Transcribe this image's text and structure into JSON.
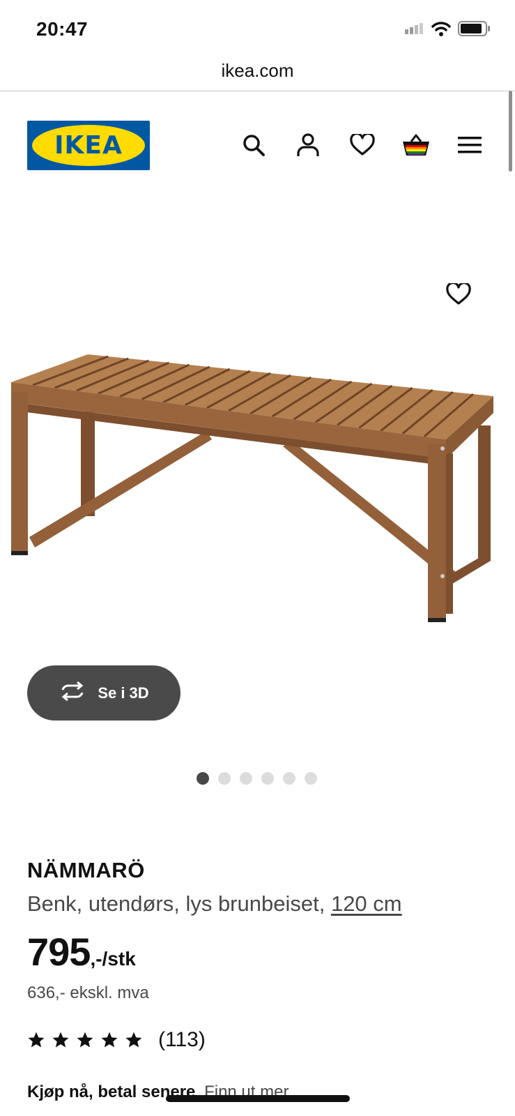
{
  "status_bar": {
    "time": "20:47",
    "icons": [
      "signal-icon",
      "wifi-icon",
      "battery-icon"
    ]
  },
  "browser": {
    "url": "ikea.com"
  },
  "header": {
    "logo_text": "IKEA",
    "icons": [
      "search-icon",
      "account-icon",
      "favorites-icon",
      "basket-icon",
      "menu-icon"
    ]
  },
  "product_image": {
    "view_3d_label": "Se i 3D",
    "carousel": {
      "total": 6,
      "active": 1
    }
  },
  "product": {
    "name": "NÄMMARÖ",
    "description": "Benk, utendørs, lys brunbeiset,",
    "size_link": "120 cm",
    "price_main": "795",
    "price_suffix": ",-/stk",
    "price_excl_vat": "636,- ekskl. mva",
    "rating_stars": 5,
    "rating_count": "(113)"
  },
  "bnpl": {
    "label": "Kjøp nå, betal senere",
    "link": "Finn ut mer"
  },
  "colors": {
    "ikea_blue": "#0058a3",
    "ikea_yellow": "#ffdb00",
    "button_dark": "#4a4a4a"
  }
}
